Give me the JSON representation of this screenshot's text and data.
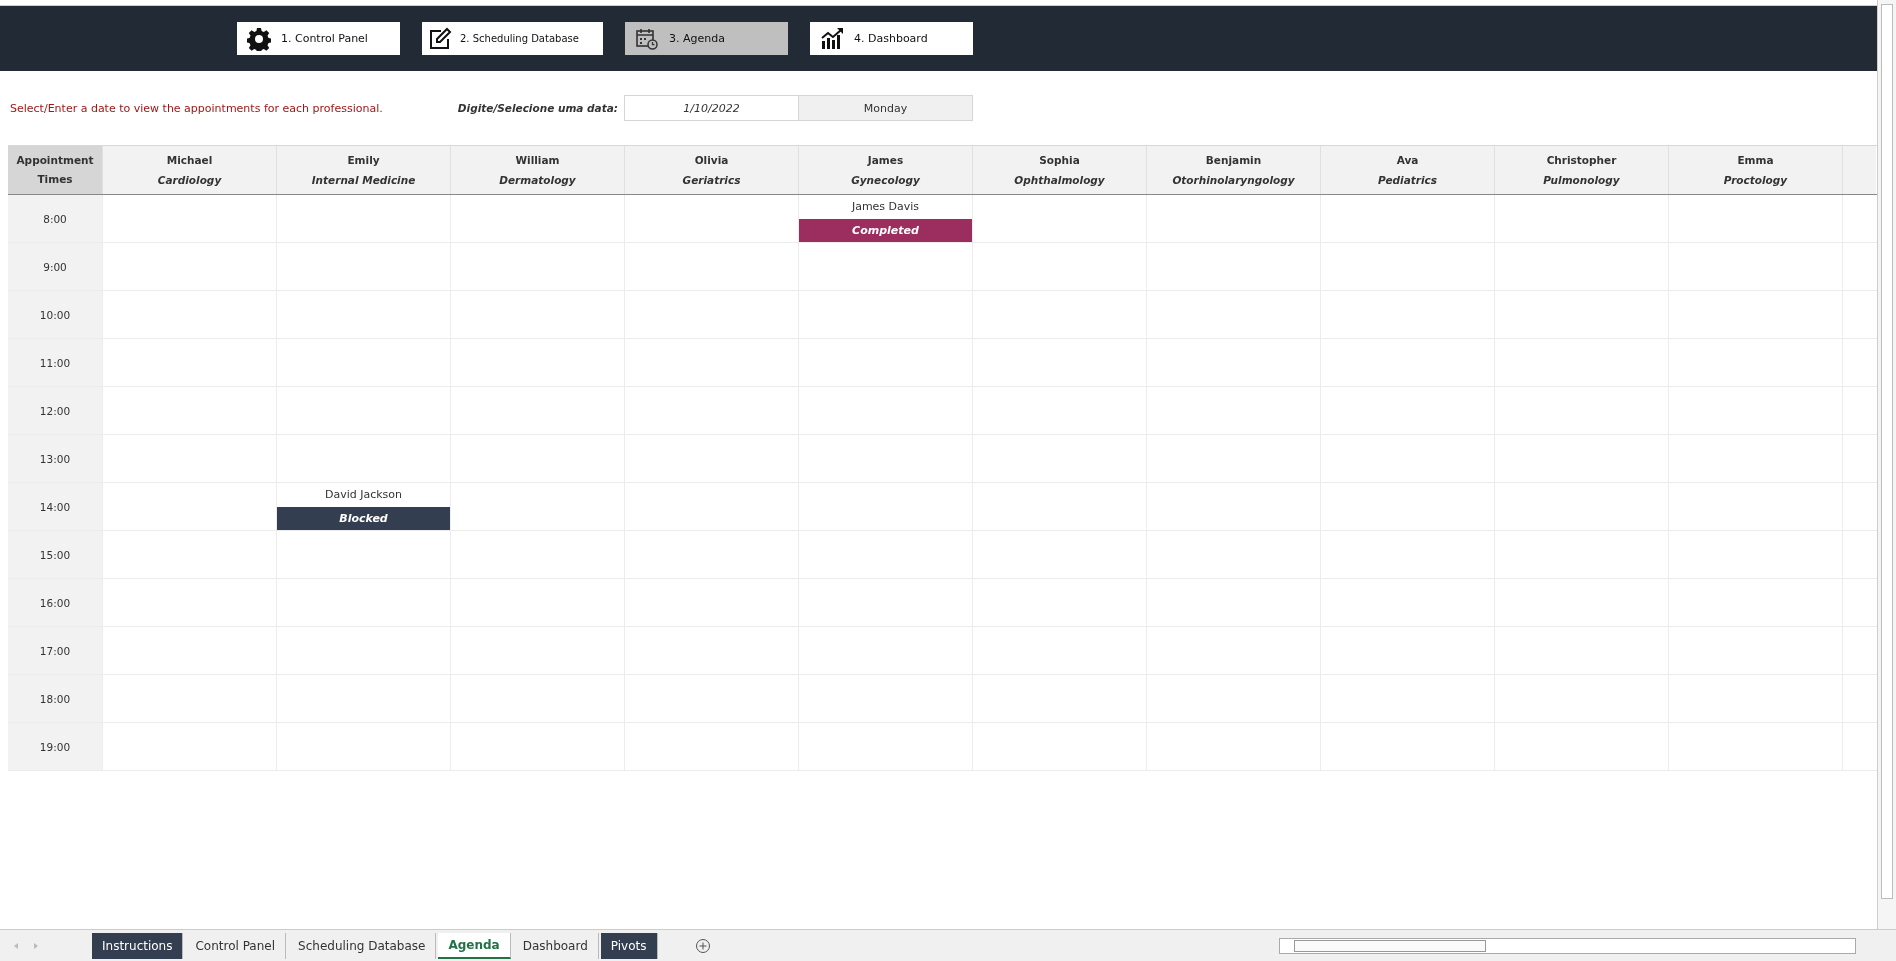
{
  "nav_buttons": [
    {
      "label": "1. Control Panel",
      "selected": false
    },
    {
      "label": "2. Scheduling Database",
      "selected": false
    },
    {
      "label": "3. Agenda",
      "selected": true
    },
    {
      "label": "4. Dashboard",
      "selected": false
    }
  ],
  "instruction": "Select/Enter a date to view the appointments for each professional.",
  "date_picker": {
    "label": "Digite/Selecione uma data:",
    "value": "1/10/2022",
    "weekday": "Monday"
  },
  "schedule": {
    "time_header": [
      "Appointment",
      "Times"
    ],
    "professionals": [
      {
        "name": "Michael",
        "specialty": "Cardiology"
      },
      {
        "name": "Emily",
        "specialty": "Internal Medicine"
      },
      {
        "name": "William",
        "specialty": "Dermatology"
      },
      {
        "name": "Olivia",
        "specialty": "Geriatrics"
      },
      {
        "name": "James",
        "specialty": "Gynecology"
      },
      {
        "name": "Sophia",
        "specialty": "Ophthalmology"
      },
      {
        "name": "Benjamin",
        "specialty": "Otorhinolaryngology"
      },
      {
        "name": "Ava",
        "specialty": "Pediatrics"
      },
      {
        "name": "Christopher",
        "specialty": "Pulmonology"
      },
      {
        "name": "Emma",
        "specialty": "Proctology"
      }
    ],
    "rows": [
      {
        "time": "8:00",
        "slots": [
          {
            "kind": "empty"
          },
          {
            "kind": "empty"
          },
          {
            "kind": "empty"
          },
          {
            "kind": "empty"
          },
          {
            "kind": "appointment",
            "patient": "James Davis",
            "status": "Completed",
            "color": "#9b2d5f"
          },
          {
            "kind": "empty"
          },
          {
            "kind": "empty"
          },
          {
            "kind": "empty"
          },
          {
            "kind": "empty"
          },
          {
            "kind": "empty"
          }
        ]
      },
      {
        "time": "9:00"
      },
      {
        "time": "10:00"
      },
      {
        "time": "11:00"
      },
      {
        "time": "12:00"
      },
      {
        "time": "13:00"
      },
      {
        "time": "14:00",
        "slots": [
          {
            "kind": "empty"
          },
          {
            "kind": "appointment",
            "patient": "David Jackson",
            "status": "Blocked",
            "color": "#333f50"
          },
          {
            "kind": "empty"
          },
          {
            "kind": "empty"
          },
          {
            "kind": "empty"
          },
          {
            "kind": "empty"
          },
          {
            "kind": "empty"
          },
          {
            "kind": "empty"
          },
          {
            "kind": "empty"
          },
          {
            "kind": "empty"
          }
        ]
      },
      {
        "time": "15:00"
      },
      {
        "time": "16:00"
      },
      {
        "time": "17:00"
      },
      {
        "time": "18:00"
      },
      {
        "time": "19:00"
      }
    ]
  },
  "sheet_tabs": [
    {
      "label": "Instructions",
      "selected": false,
      "color": "#333f50"
    },
    {
      "label": "Control Panel",
      "selected": false
    },
    {
      "label": "Scheduling Database",
      "selected": false
    },
    {
      "label": "Agenda",
      "selected": true
    },
    {
      "label": "Dashboard",
      "selected": false
    },
    {
      "label": "Pivots",
      "selected": false,
      "color": "#333f50"
    }
  ]
}
